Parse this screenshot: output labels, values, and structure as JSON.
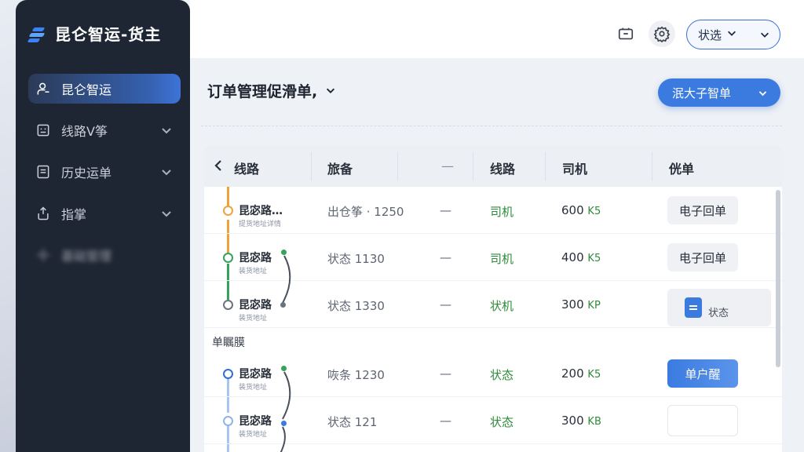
{
  "app": {
    "title": "昆仑智运-货主"
  },
  "sidebar": {
    "items": [
      {
        "label": "昆仑智运",
        "icon": "user-icon",
        "active": true
      },
      {
        "label": "线路Ⅴ筝",
        "icon": "board-icon",
        "active": false
      },
      {
        "label": "历史运单",
        "icon": "document-icon",
        "active": false
      },
      {
        "label": "指掌",
        "icon": "share-icon",
        "active": false
      },
      {
        "label": "基础管理",
        "icon": "gear-icon",
        "active": false
      }
    ]
  },
  "topbar": {
    "filter_label": "状选",
    "icons": [
      "battery-icon",
      "gear-icon"
    ]
  },
  "main": {
    "title": "订单管理促滑单,",
    "primary_button": "泯大子智单"
  },
  "table": {
    "headers": [
      "线路",
      "旅备",
      "—",
      "线路",
      "司机",
      "侊单"
    ],
    "group_label": "单瞩膜",
    "rows": [
      {
        "route": "昆宓路…",
        "sub": "提货地址详情",
        "col2": "出仓筝 · 1250",
        "dash": "—",
        "col4": "司机",
        "driver": "600",
        "unit": "K5",
        "action": "电子回单",
        "action_type": "normal"
      },
      {
        "route": "昆宓路",
        "sub": "装货地址",
        "col2": "状态  1130",
        "dash": "—",
        "col4": "司机",
        "driver": "400",
        "unit": "K5",
        "action": "电子回单",
        "action_type": "normal"
      },
      {
        "route": "昆宓路",
        "sub": "装货地址",
        "col2": "状态  1330",
        "dash": "—",
        "col4": "状机",
        "driver": "300",
        "unit": "KP",
        "action": "状态",
        "action_type": "doc"
      },
      {
        "route": "昆宓路",
        "sub": "装货地址",
        "col2": "咴条  1230",
        "dash": "—",
        "col4": "状态",
        "driver": "200",
        "unit": "K5",
        "action": "单户醒",
        "action_type": "primary"
      },
      {
        "route": "昆宓路",
        "sub": "装货地址",
        "col2": "状态  121",
        "dash": "—",
        "col4": "状态",
        "driver": "300",
        "unit": "KB",
        "action": "",
        "action_type": "empty"
      }
    ]
  },
  "colors": {
    "accent": "#3b7be0",
    "sidebar_bg": "#1f2633",
    "status_green": "#2e8b3a",
    "node_orange": "#f0a23a"
  }
}
